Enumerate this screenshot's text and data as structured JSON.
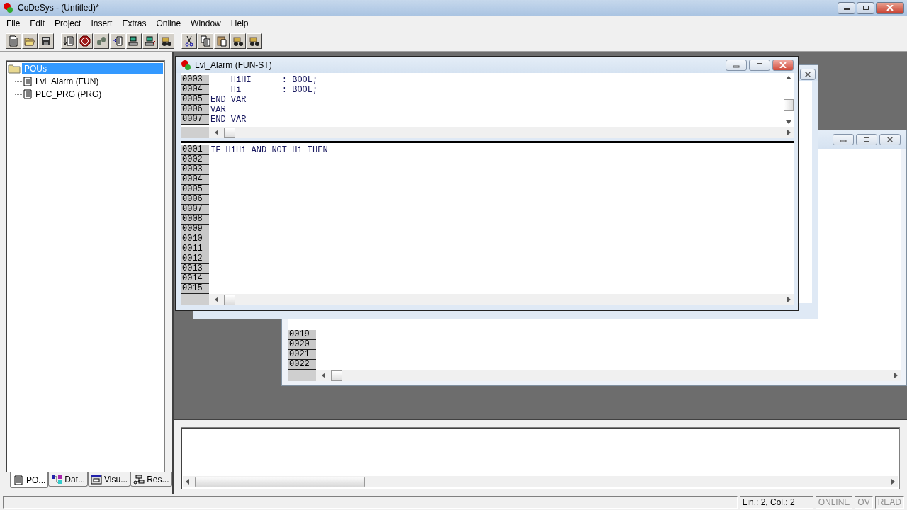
{
  "window": {
    "title": "CoDeSys - (Untitled)*"
  },
  "menu": [
    "File",
    "Edit",
    "Project",
    "Insert",
    "Extras",
    "Online",
    "Window",
    "Help"
  ],
  "tree": {
    "label": "POUs",
    "selected": true,
    "children": [
      {
        "label": "Lvl_Alarm (FUN)",
        "selected": false
      },
      {
        "label": "PLC_PRG (PRG)",
        "selected": false
      }
    ]
  },
  "panel_tabs": [
    {
      "label": "PO...",
      "selected": true
    },
    {
      "label": "Dat...",
      "selected": false
    },
    {
      "label": "Visu...",
      "selected": false
    },
    {
      "label": "Res...",
      "selected": false
    }
  ],
  "editor": {
    "title": "Lvl_Alarm (FUN-ST)",
    "declaration_lines": [
      {
        "number": "0003",
        "text": "    HiHI      : BOOL;"
      },
      {
        "number": "0004",
        "text": "    Hi        : BOOL;"
      },
      {
        "number": "0005",
        "text": "END_VAR"
      },
      {
        "number": "0006",
        "text": "VAR"
      },
      {
        "number": "0007",
        "text": "END_VAR"
      }
    ],
    "body_lines": [
      {
        "number": "0001",
        "text": "IF HiHi AND NOT Hi THEN",
        "caret": false
      },
      {
        "number": "0002",
        "caret": true
      },
      {
        "number": "0003",
        "caret": false
      },
      {
        "number": "0004",
        "caret": false
      },
      {
        "number": "0005",
        "caret": false
      },
      {
        "number": "0006",
        "caret": false
      },
      {
        "number": "0007",
        "caret": false
      },
      {
        "number": "0008",
        "caret": false
      },
      {
        "number": "0009",
        "caret": false
      },
      {
        "number": "0010",
        "caret": false
      },
      {
        "number": "0011",
        "caret": false
      },
      {
        "number": "0012",
        "caret": false
      },
      {
        "number": "0013",
        "caret": false
      },
      {
        "number": "0014",
        "caret": false
      },
      {
        "number": "0015",
        "caret": false
      }
    ]
  },
  "back_editor": {
    "line_numbers": [
      "0019",
      "0020",
      "0021",
      "0022"
    ]
  },
  "status_bar": {
    "position": "Lin.: 2, Col.: 2",
    "flags": [
      {
        "label": "ONLINE",
        "active": false
      },
      {
        "label": "OV",
        "active": false
      },
      {
        "label": "READ",
        "active": false
      }
    ]
  }
}
